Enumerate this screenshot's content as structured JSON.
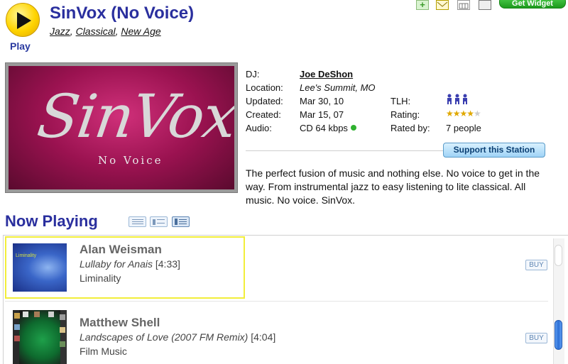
{
  "station": {
    "play_label": "Play",
    "title": "SinVox (No Voice)",
    "genres": [
      "Jazz",
      "Classical",
      "New Age"
    ]
  },
  "toolbar": {
    "plus_label": "+",
    "widget_label": "Get Widget"
  },
  "logo": {
    "main_text": "SinVox",
    "sub_text": "No Voice"
  },
  "info": {
    "dj_label": "DJ:",
    "dj_value": "Joe DeShon",
    "location_label": "Location:",
    "location_value": "Lee's Summit, MO",
    "updated_label": "Updated:",
    "updated_value": "Mar 30, 10",
    "created_label": "Created:",
    "created_value": "Mar 15, 07",
    "audio_label": "Audio:",
    "audio_value": "CD 64 kbps",
    "tlh_label": "TLH:",
    "rating_label": "Rating:",
    "rating_value": 3.5,
    "rating_max": 5,
    "rated_by_label": "Rated by:",
    "rated_by_value": "7 people",
    "audio_status_color": "#2fb12f"
  },
  "support_button_label": "Support this Station",
  "description": "The perfect fusion of music and nothing else. No voice to get in the way. From instrumental jazz to easy listening to lite classical. All music. No voice. SinVox.",
  "now_playing": {
    "heading": "Now Playing",
    "view_modes": [
      "list-view-icon",
      "compact-view-icon",
      "detail-view-icon"
    ],
    "tracks": [
      {
        "art_text": "Liminality",
        "artist": "Alan Weisman",
        "title": "Lullaby for Anais",
        "duration": "[4:33]",
        "album": "Liminality",
        "buy_label": "BUY"
      },
      {
        "art_text": "",
        "artist": "Matthew Shell",
        "title": "Landscapes of Love (2007 FM Remix)",
        "duration": "[4:04]",
        "album": "Film Music",
        "buy_label": "BUY"
      }
    ]
  },
  "colors": {
    "title_blue": "#2a2f9e",
    "highlight_yellow": "#f2ee3a",
    "widget_green": "#1d9a1d"
  }
}
